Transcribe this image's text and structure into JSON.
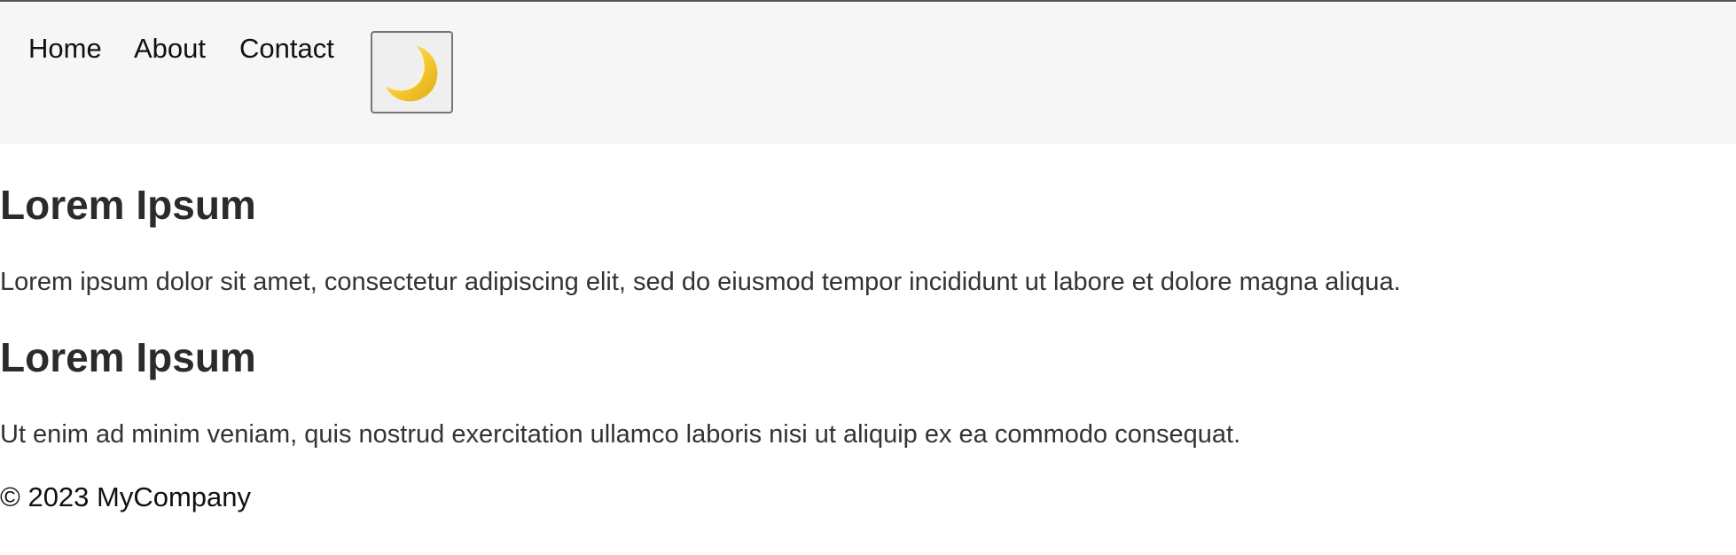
{
  "nav": {
    "items": [
      {
        "label": "Home"
      },
      {
        "label": "About"
      },
      {
        "label": "Contact"
      }
    ],
    "theme_toggle_icon": "crescent-moon-icon"
  },
  "content": {
    "sections": [
      {
        "heading": "Lorem Ipsum",
        "text": "Lorem ipsum dolor sit amet, consectetur adipiscing elit, sed do eiusmod tempor incididunt ut labore et dolore magna aliqua."
      },
      {
        "heading": "Lorem Ipsum",
        "text": "Ut enim ad minim veniam, quis nostrud exercitation ullamco laboris nisi ut aliquip ex ea commodo consequat."
      }
    ]
  },
  "footer": {
    "text": "© 2023 MyCompany"
  },
  "colors": {
    "nav_background": "#f6f6f6",
    "moon": "#f5c82f",
    "text": "#333333"
  }
}
